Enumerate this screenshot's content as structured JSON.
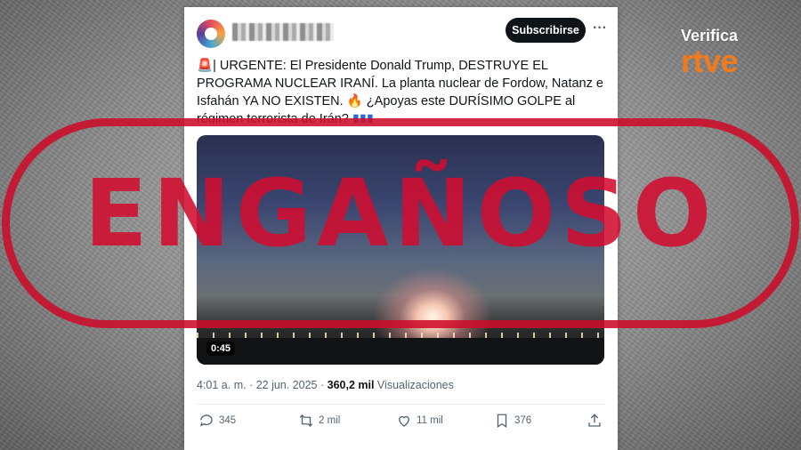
{
  "brand": {
    "line1": "Verifica",
    "line2": "rtve"
  },
  "stamp": {
    "label": "ENGAÑOSO"
  },
  "post": {
    "subscribe_label": "Subscribirse",
    "more_icon": "···",
    "text": "| URGENTE: El Presidente Donald Trump, DESTRUYE EL PROGRAMA NUCLEAR IRANÍ. La planta nuclear de Fordow, Natanz e Isfahán YA NO EXISTEN. 🔥 ¿Apoyas este DURÍSIMO GOLPE al régimen terrorista de Irán? ",
    "video_duration": "0:45",
    "timestamp": "4:01 a. m. · 22 jun. 2025 · ",
    "views_count": "360,2 mil",
    "views_label": " Visualizaciones",
    "actions": {
      "replies": "345",
      "reposts": "2 mil",
      "likes": "11 mil",
      "bookmarks": "376"
    }
  },
  "icons": [
    "siren-icon",
    "flags-icon",
    "reply-icon",
    "repost-icon",
    "like-icon",
    "bookmark-icon",
    "share-icon"
  ],
  "colors": {
    "stamp": "#cd0c2a",
    "brand_orange": "#f07a1c",
    "button_dark": "#0f1419"
  }
}
